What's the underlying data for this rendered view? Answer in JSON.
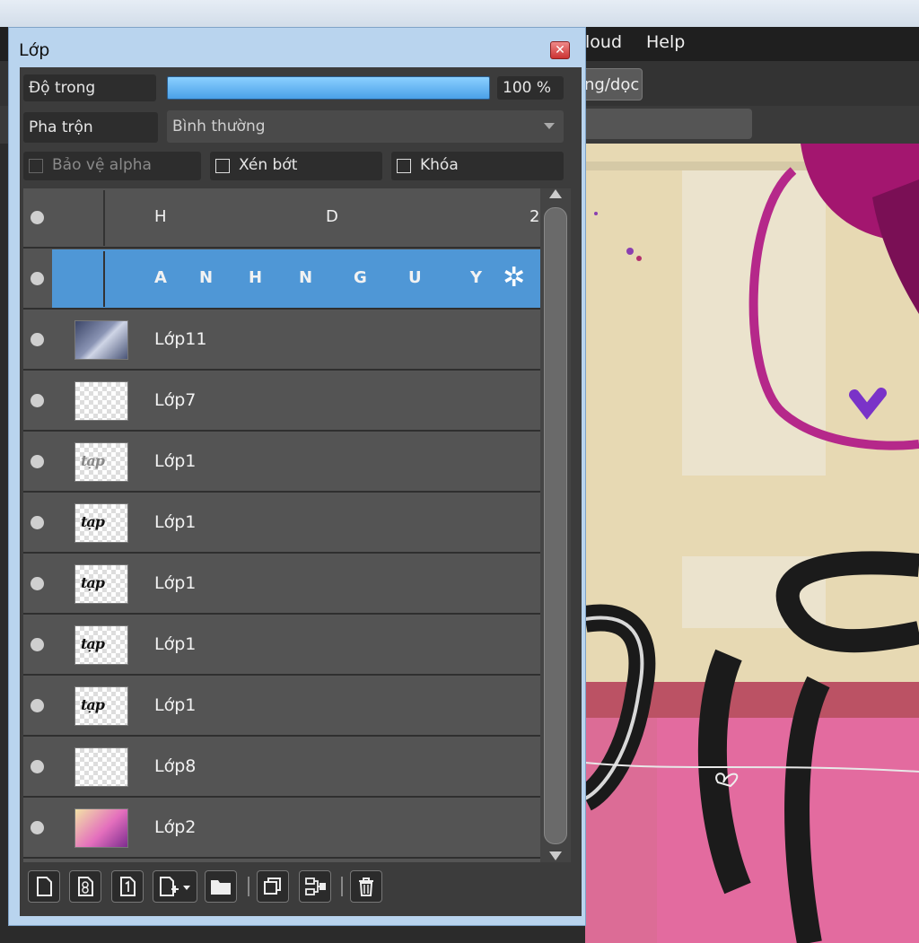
{
  "app": {
    "menu": [
      "loud",
      "Help"
    ],
    "toolbar_button": "ng/dọc"
  },
  "panel": {
    "title": "Lớp",
    "close_icon": "close-icon",
    "opacity": {
      "label": "Độ trong",
      "value": "100 %",
      "level": 1.0
    },
    "blend": {
      "label": "Pha trộn",
      "value": "Bình thường"
    },
    "checkboxes": [
      {
        "label": "Bảo vệ alpha",
        "checked": false,
        "enabled": false
      },
      {
        "label": "Xén bớt",
        "checked": false,
        "enabled": true
      },
      {
        "label": "Khóa",
        "checked": false,
        "enabled": true
      }
    ],
    "layers": [
      {
        "type": "text",
        "letters": [
          "H",
          "D",
          "2"
        ],
        "selected": false
      },
      {
        "type": "text",
        "letters": [
          "A",
          "N",
          "H",
          "N",
          "G",
          "U",
          "Y"
        ],
        "selected": true
      },
      {
        "name": "Lớp11",
        "thumb": "sky"
      },
      {
        "name": "Lớp7",
        "thumb": "empty"
      },
      {
        "name": "Lớp1",
        "thumb": "text-faint"
      },
      {
        "name": "Lớp1",
        "thumb": "text"
      },
      {
        "name": "Lớp1",
        "thumb": "text"
      },
      {
        "name": "Lớp1",
        "thumb": "text"
      },
      {
        "name": "Lớp1",
        "thumb": "text"
      },
      {
        "name": "Lớp8",
        "thumb": "empty"
      },
      {
        "name": "Lớp2",
        "thumb": "art"
      }
    ],
    "thumb_text": "tạp",
    "bottom_icons": [
      "new-layer-icon",
      "new-vector-layer-icon",
      "new-text-layer-icon",
      "add-layer-dropdown-icon",
      "folder-icon",
      "duplicate-layer-icon",
      "merge-layer-icon",
      "delete-layer-icon"
    ]
  },
  "colors": {
    "accent": "#4f97d6",
    "panel_border": "#b9d4ee",
    "background": "#3c3c3c"
  }
}
